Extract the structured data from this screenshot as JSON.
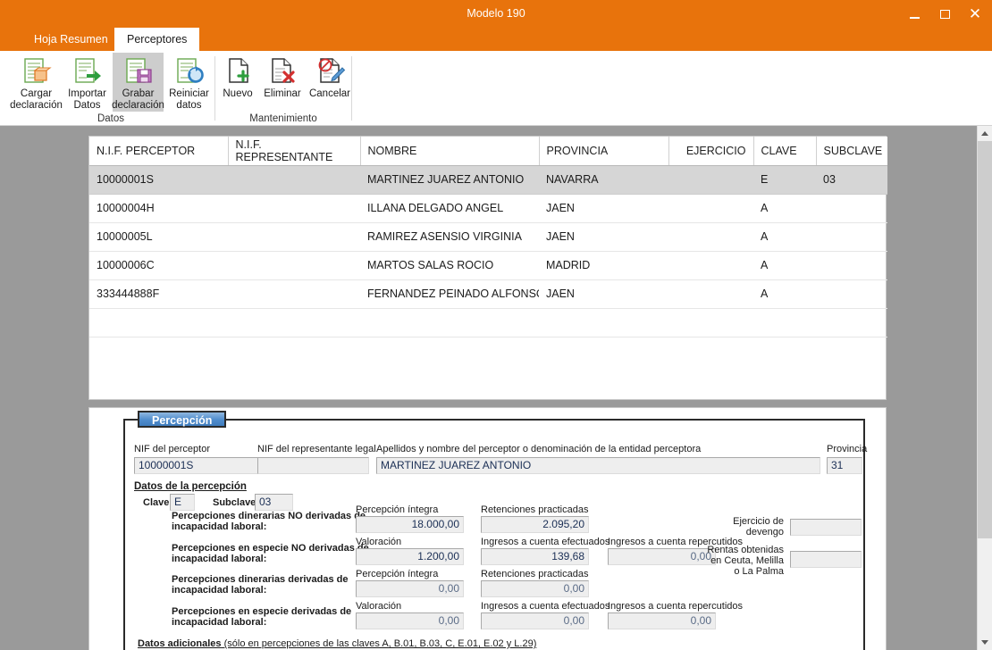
{
  "window": {
    "title": "Modelo 190",
    "minimize_label": "Minimizar",
    "maximize_label": "Maximizar",
    "close_label": "✕",
    "accent_color": "#e8730c"
  },
  "tabs": [
    {
      "label": "Hoja Resumen",
      "active": false
    },
    {
      "label": "Perceptores",
      "active": true
    }
  ],
  "ribbon": {
    "groups": [
      {
        "label": "Datos",
        "buttons": [
          {
            "label_line1": "Cargar",
            "label_line2": "declaración",
            "icon": "load-declaration-icon",
            "selected": false
          },
          {
            "label_line1": "Importar",
            "label_line2": "Datos",
            "icon": "import-data-icon",
            "selected": false
          },
          {
            "label_line1": "Grabar",
            "label_line2": "declaración",
            "icon": "save-declaration-icon",
            "selected": true
          },
          {
            "label_line1": "Reiniciar",
            "label_line2": "datos",
            "icon": "reset-data-icon",
            "selected": false
          }
        ]
      },
      {
        "label": "Mantenimiento",
        "buttons": [
          {
            "label_line1": "Nuevo",
            "label_line2": "",
            "icon": "new-record-icon",
            "selected": false
          },
          {
            "label_line1": "Eliminar",
            "label_line2": "",
            "icon": "delete-record-icon",
            "selected": false
          },
          {
            "label_line1": "Cancelar",
            "label_line2": "",
            "icon": "cancel-edit-icon",
            "selected": false
          }
        ]
      }
    ]
  },
  "grid": {
    "columns": [
      {
        "label": "N.I.F. PERCEPTOR",
        "align": "left"
      },
      {
        "label": "N.I.F. REPRESENTANTE",
        "align": "left"
      },
      {
        "label": "NOMBRE",
        "align": "left"
      },
      {
        "label": "PROVINCIA",
        "align": "left"
      },
      {
        "label": "EJERCICIO",
        "align": "right"
      },
      {
        "label": "CLAVE",
        "align": "left"
      },
      {
        "label": "SUBCLAVE",
        "align": "left"
      }
    ],
    "rows": [
      {
        "nif": "10000001S",
        "nif_rep": "",
        "nombre": "MARTINEZ JUAREZ ANTONIO",
        "provincia": "NAVARRA",
        "ejercicio": "",
        "clave": "E",
        "subclave": "03",
        "selected": true
      },
      {
        "nif": "10000004H",
        "nif_rep": "",
        "nombre": "ILLANA DELGADO ANGEL",
        "provincia": "JAEN",
        "ejercicio": "",
        "clave": "A",
        "subclave": "",
        "selected": false
      },
      {
        "nif": "10000005L",
        "nif_rep": "",
        "nombre": "RAMIREZ ASENSIO VIRGINIA",
        "provincia": "JAEN",
        "ejercicio": "",
        "clave": "A",
        "subclave": "",
        "selected": false
      },
      {
        "nif": "10000006C",
        "nif_rep": "",
        "nombre": "MARTOS SALAS ROCIO",
        "provincia": "MADRID",
        "ejercicio": "",
        "clave": "A",
        "subclave": "",
        "selected": false
      },
      {
        "nif": "333444888F",
        "nif_rep": "",
        "nombre": "FERNANDEZ PEINADO ALFONSO",
        "provincia": "JAEN",
        "ejercicio": "",
        "clave": "A",
        "subclave": "",
        "selected": false
      }
    ]
  },
  "form": {
    "groupbox_title": "Percepción",
    "nif_perceptor_label": "NIF del perceptor",
    "nif_perceptor_value": "10000001S",
    "nif_representante_label": "NIF del representante legal",
    "nif_representante_value": "",
    "nombre_label": "Apellidos y nombre del perceptor o denominación de la entidad perceptora",
    "nombre_value": "MARTINEZ JUAREZ ANTONIO",
    "provincia_label": "Provincia",
    "provincia_value": "31",
    "section_title": "Datos de la percepción",
    "clave_label": "Clave:",
    "clave_value": "E",
    "subclave_label": "Subclave:",
    "subclave_value": "03",
    "rows": [
      {
        "concept": "Percepciones dinerarias NO derivadas de incapacidad laboral:",
        "concept_line1": "Percepciones dinerarias NO derivadas de",
        "concept_line2": "incapacidad laboral:",
        "col1_label": "Percepción íntegra",
        "col1_value": "18.000,00",
        "col2_label": "Retenciones practicadas",
        "col2_value": "2.095,20",
        "col3_label": "",
        "col3_value": ""
      },
      {
        "concept": "Percepciones en especie NO derivadas de incapacidad laboral:",
        "concept_line1": "Percepciones en especie NO derivadas de",
        "concept_line2": "incapacidad laboral:",
        "col1_label": "Valoración",
        "col1_value": "1.200,00",
        "col2_label": "Ingresos a cuenta efectuados",
        "col2_value": "139,68",
        "col3_label": "Ingresos a cuenta repercutidos",
        "col3_value": "0,00"
      },
      {
        "concept": "Percepciones dinerarias derivadas de incapacidad laboral:",
        "concept_line1": "Percepciones dinerarias derivadas de",
        "concept_line2": "incapacidad laboral:",
        "col1_label": "Percepción íntegra",
        "col1_value": "0,00",
        "col2_label": "Retenciones practicadas",
        "col2_value": "0,00",
        "col3_label": "",
        "col3_value": ""
      },
      {
        "concept": "Percepciones en especie derivadas de incapacidad laboral:",
        "concept_line1": "Percepciones en especie derivadas de",
        "concept_line2": "incapacidad laboral:",
        "col1_label": "Valoración",
        "col1_value": "0,00",
        "col2_label": "Ingresos a cuenta efectuados",
        "col2_value": "0,00",
        "col3_label": "Ingresos a cuenta repercutidos",
        "col3_value": "0,00"
      }
    ],
    "ejercicio_devengo_label_l1": "Ejercicio de",
    "ejercicio_devengo_label_l2": "devengo",
    "ejercicio_devengo_value": "",
    "ceuta_label_l1": "Rentas obtenidas",
    "ceuta_label_l2": "en Ceuta, Melilla",
    "ceuta_label_l3": "o La Palma",
    "ceuta_value": "",
    "datos_adicionales_bold": "Datos adicionales",
    "datos_adicionales_rest": " (sólo en percepciones de las claves A, B.01, B.03, C, E.01, E.02 y L.29)"
  },
  "scrollbar": {
    "up_label": "scroll-up",
    "down_label": "scroll-down"
  }
}
